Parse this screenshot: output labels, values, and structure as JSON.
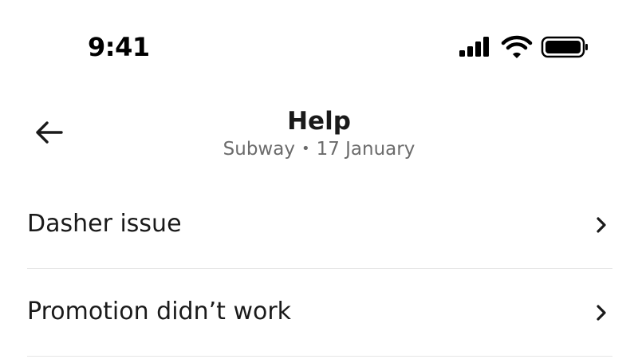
{
  "status_bar": {
    "time": "9:41",
    "icons": [
      "cellular-signal-icon",
      "wifi-icon",
      "battery-icon"
    ]
  },
  "header": {
    "back_icon": "arrow-left-icon",
    "title": "Help",
    "subtitle": {
      "store": "Subway",
      "separator": "•",
      "date": "17 January"
    }
  },
  "options": [
    {
      "label": "Dasher issue",
      "icon": "chevron-right-icon"
    },
    {
      "label": "Promotion didn’t work",
      "icon": "chevron-right-icon"
    }
  ],
  "colors": {
    "text_primary": "#1a1a1a",
    "text_secondary": "#6b6b6b",
    "divider": "#e6e6e6",
    "background": "#ffffff"
  }
}
